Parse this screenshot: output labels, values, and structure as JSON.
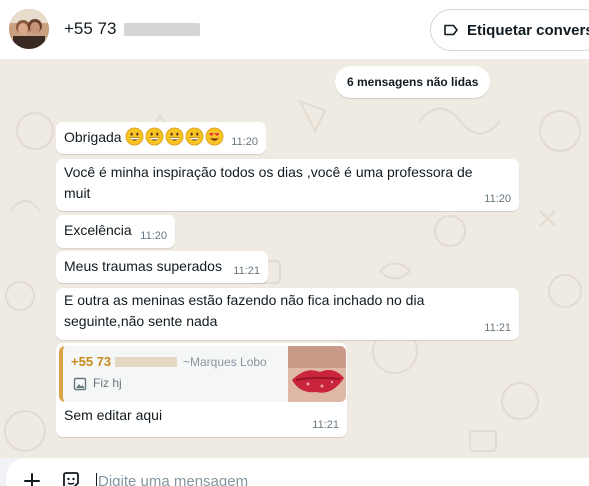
{
  "header": {
    "contact_number": "+55 73",
    "tag_button_label": "Etiquetar conversa"
  },
  "chat": {
    "unread_badge": "6 mensagens não lidas",
    "messages": [
      {
        "text": "Obrigada",
        "emoji": [
          "grinning-face",
          "grinning-face",
          "grinning-face",
          "grinning-face",
          "smiling-face-with-heart-eyes"
        ],
        "time": "11:20"
      },
      {
        "text": "Você é minha inspiração todos os dias ,você é uma professora de muit",
        "time": "11:20"
      },
      {
        "text": "Excelência",
        "time": "11:20"
      },
      {
        "text": "Meus traumas superados",
        "time": "11:21"
      },
      {
        "text": "E outra as meninas estão fazendo não fica inchado no dia seguinte,não sente nada",
        "time": "11:21"
      },
      {
        "quote": {
          "author": "+55 73",
          "push_name": "~Marques Lobo",
          "content": "Fiz hj",
          "content_icon": "image-icon"
        },
        "text": "Sem editar aqui",
        "time": "11:21"
      }
    ]
  },
  "composer": {
    "placeholder": "Digite uma mensagem",
    "attach_icon": "plus-icon",
    "emoji_icon": "sticker-icon"
  },
  "colors": {
    "chat_background": "#efeae2",
    "bubble_incoming": "#ffffff",
    "quote_accent": "#d9a34a",
    "timestamp": "#667781"
  }
}
